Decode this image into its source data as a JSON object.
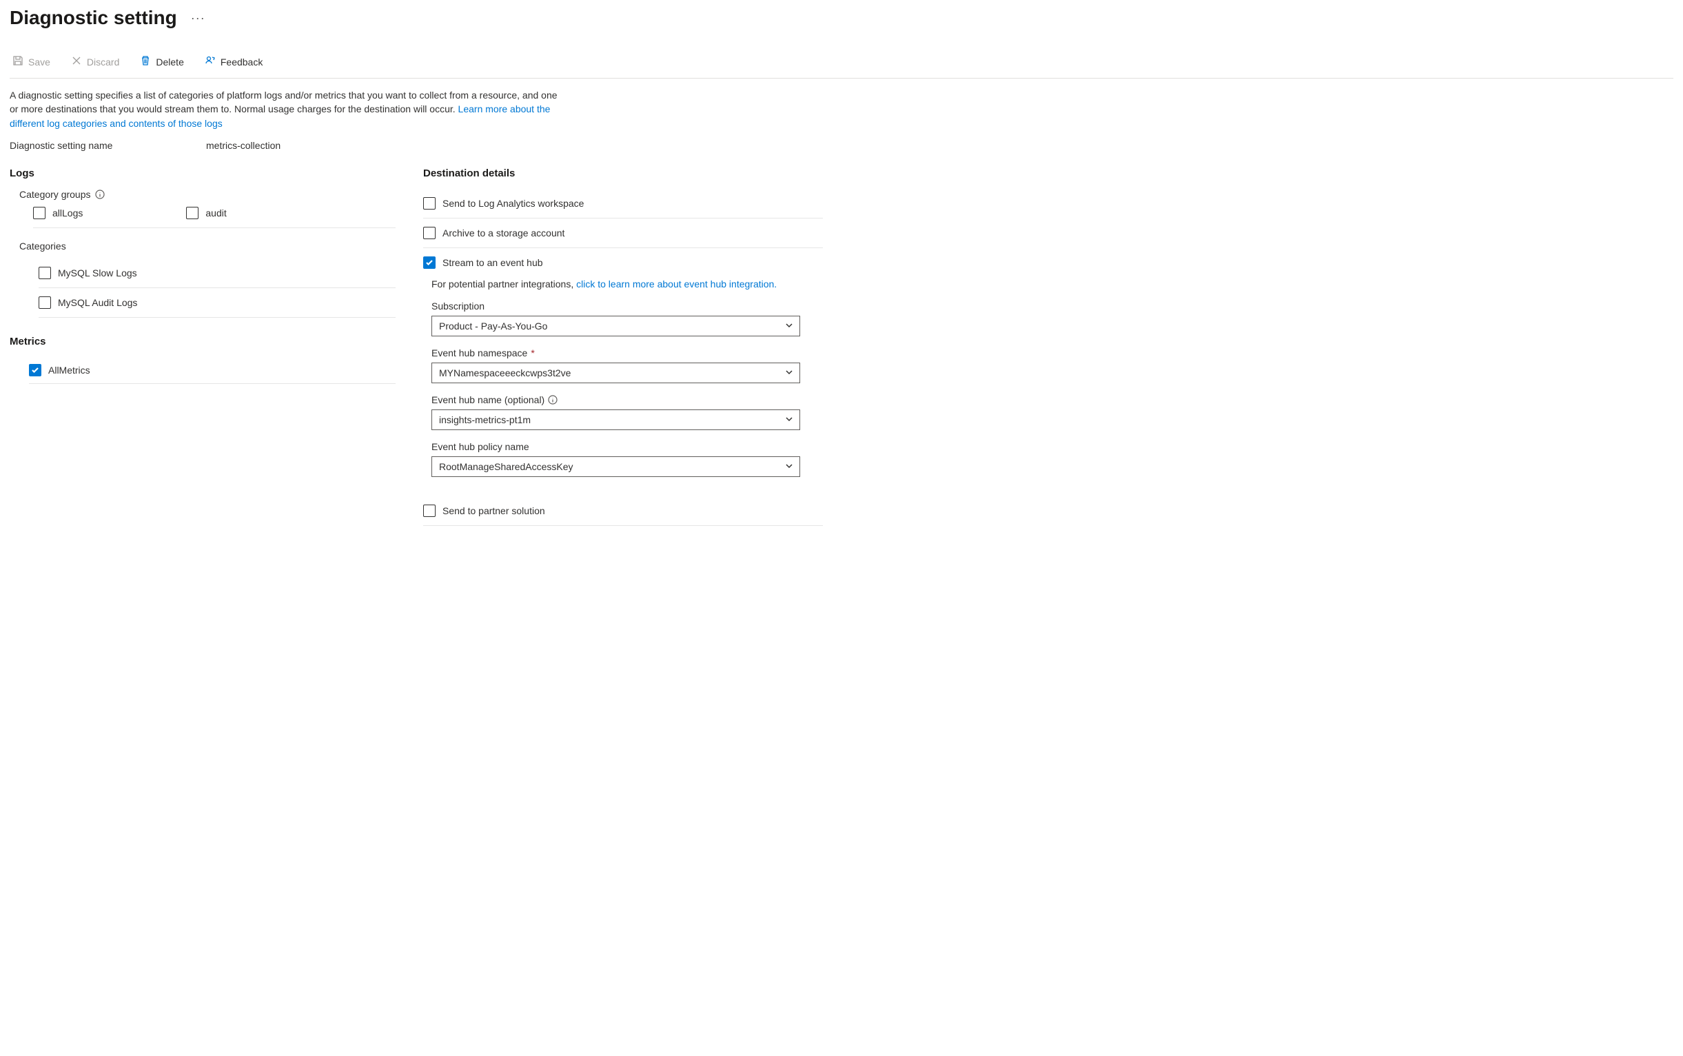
{
  "header": {
    "title": "Diagnostic setting"
  },
  "toolbar": {
    "save": "Save",
    "discard": "Discard",
    "delete": "Delete",
    "feedback": "Feedback"
  },
  "intro": {
    "text": "A diagnostic setting specifies a list of categories of platform logs and/or metrics that you want to collect from a resource, and one or more destinations that you would stream them to. Normal usage charges for the destination will occur. ",
    "link": "Learn more about the different log categories and contents of those logs"
  },
  "setting": {
    "name_label": "Diagnostic setting name",
    "name_value": "metrics-collection"
  },
  "logs": {
    "heading": "Logs",
    "category_groups_label": "Category groups",
    "groups": {
      "allLogs": "allLogs",
      "audit": "audit"
    },
    "categories_label": "Categories",
    "categories": {
      "slow": "MySQL Slow Logs",
      "audit": "MySQL Audit Logs"
    }
  },
  "metrics": {
    "heading": "Metrics",
    "all": "AllMetrics"
  },
  "destinations": {
    "heading": "Destination details",
    "log_analytics": "Send to Log Analytics workspace",
    "storage": "Archive to a storage account",
    "event_hub": "Stream to an event hub",
    "partner": "Send to partner solution",
    "eh_details": {
      "hint_prefix": "For potential partner integrations, ",
      "hint_link": "click to learn more about event hub integration.",
      "subscription_label": "Subscription",
      "subscription_value": "Product - Pay-As-You-Go",
      "namespace_label": "Event hub namespace",
      "namespace_value": "MYNamespaceeeckcwps3t2ve",
      "name_label": "Event hub name (optional)",
      "name_value": "insights-metrics-pt1m",
      "policy_label": "Event hub policy name",
      "policy_value": "RootManageSharedAccessKey"
    }
  }
}
